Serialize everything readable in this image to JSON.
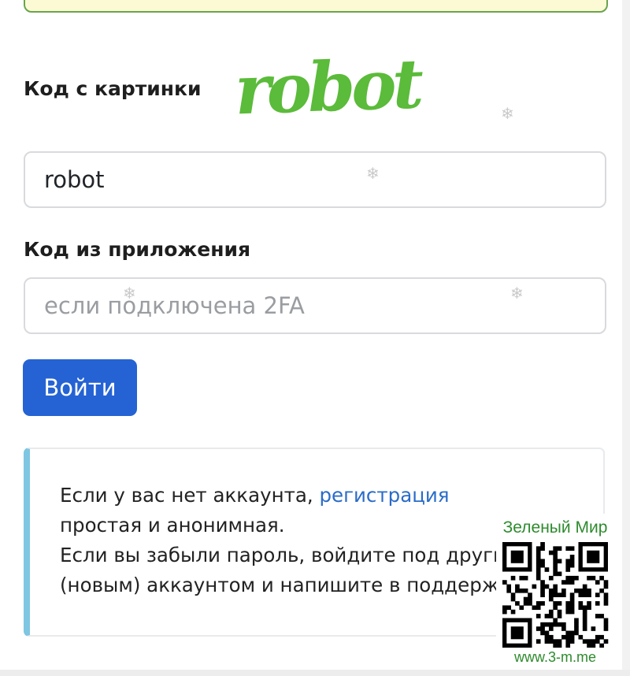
{
  "captcha": {
    "label": "Код с картинки",
    "image_text": "robot",
    "input_value": "robot"
  },
  "app_code": {
    "label": "Код из приложения",
    "placeholder": "если подключена 2FA"
  },
  "login_button": "Войти",
  "info": {
    "line1_text": "Если у вас нет аккаунта,",
    "register_link": "регистрация",
    "line2": "простая и анонимная.",
    "line3": "Если вы забыли пароль, войдите под другим",
    "line4": "(новым) аккаунтом и напишите в поддержку."
  },
  "watermark": {
    "title": "Зеленый Мир",
    "url": "www.3-m.me"
  },
  "colors": {
    "captcha_green": "#5bbb3a",
    "button_blue": "#2563d4",
    "link_blue": "#2a6cc8",
    "info_accent": "#7ec6e2",
    "alert_border": "#6aa44d",
    "alert_bg": "#fbfad5"
  }
}
